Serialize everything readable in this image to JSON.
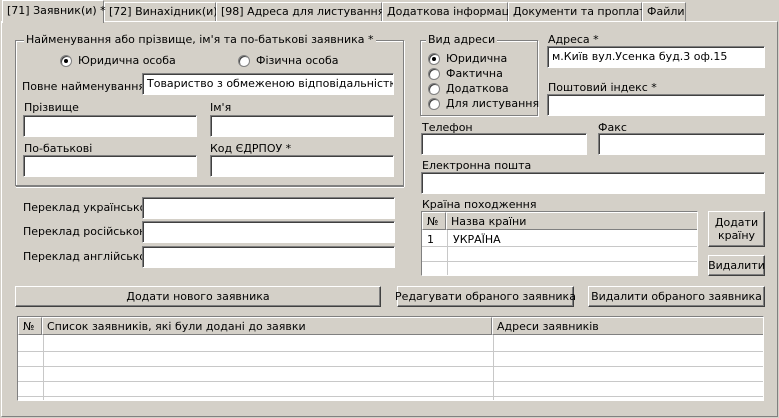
{
  "tabs": [
    {
      "label": "[71] Заявник(и) *"
    },
    {
      "label": "[72] Винахідник(и) *"
    },
    {
      "label": "[98] Адреса для листування *"
    },
    {
      "label": "Додаткова інформація"
    },
    {
      "label": "Документи та проплати"
    },
    {
      "label": "Файли"
    }
  ],
  "applicant": {
    "group_title": "Найменування або прізвище, ім'я та по-батькові заявника *",
    "type_legal": "Юридична особа",
    "type_individual": "Фізична особа",
    "full_name_label": "Повне найменування *",
    "full_name_value": "Товариство з обмеженою відповідальністю \"ДЕ",
    "surname_label": "Прізвище",
    "surname_value": "",
    "name_label": "Ім'я",
    "name_value": "",
    "patronymic_label": "По-батькові",
    "patronymic_value": "",
    "edrpou_label": "Код ЄДРПОУ *",
    "edrpou_value": "",
    "tr_ua_label": "Переклад українською",
    "tr_ru_label": "Переклад російською",
    "tr_en_label": "Переклад англійською"
  },
  "address_type": {
    "group_title": "Вид адреси",
    "options": [
      "Юридична",
      "Фактична",
      "Додаткова",
      "Для листування"
    ],
    "selected": "Юридична"
  },
  "contact": {
    "address_label": "Адреса *",
    "address_value": "м.Київ вул.Усенка буд.3 оф.15",
    "postal_label": "Поштовий індекс *",
    "postal_value": "",
    "phone_label": "Телефон",
    "fax_label": "Факс",
    "email_label": "Електронна пошта",
    "country_label": "Країна походження",
    "country_grid": {
      "col_num": "№",
      "col_name": "Назва країни",
      "rows": [
        {
          "num": "1",
          "name": "УКРАЇНА"
        }
      ]
    },
    "add_country": "Додати країну",
    "delete": "Видалити"
  },
  "actions": {
    "add": "Додати нового заявника",
    "edit": "Редагувати обраного заявника",
    "remove": "Видалити обраного заявника"
  },
  "applicants_list": {
    "col_num": "№",
    "col_list": "Список заявників, які були додані до заявки",
    "col_addr": "Адреси заявників"
  }
}
